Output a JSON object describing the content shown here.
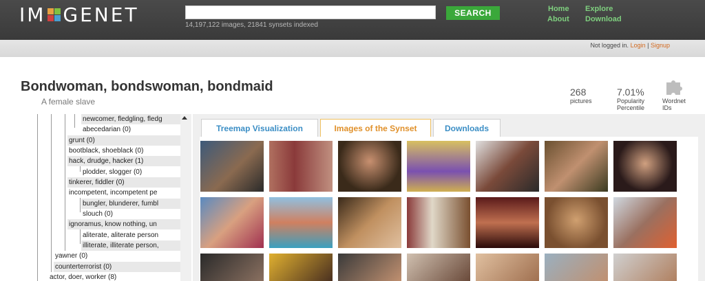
{
  "header": {
    "logo_left": "IM",
    "logo_right": "GENET",
    "search_placeholder": "",
    "search_button": "SEARCH",
    "stats": "14,197,122 images, 21841 synsets indexed",
    "nav": [
      {
        "label": "Home"
      },
      {
        "label": "About"
      },
      {
        "label": "Explore"
      },
      {
        "label": "Download"
      }
    ]
  },
  "login": {
    "text": "Not logged in.",
    "login": "Login",
    "sep": "|",
    "signup": "Signup"
  },
  "synset": {
    "title": "Bondwoman, bondswoman, bondmaid",
    "gloss": "A female slave"
  },
  "stats": [
    {
      "value": "268",
      "label": "pictures"
    },
    {
      "value": "7.01%",
      "label": "Popularity Percentile"
    },
    {
      "value": "",
      "label": "Wordnet IDs"
    }
  ],
  "tabs": [
    {
      "label": "Treemap Visualization"
    },
    {
      "label": "Images of the Synset"
    },
    {
      "label": "Downloads"
    }
  ],
  "tree": [
    {
      "label": "newcomer, fledgling, fledg"
    },
    {
      "label": "abecedarian (0)"
    },
    {
      "label": "grunt (0)"
    },
    {
      "label": "bootblack, shoeblack (0)"
    },
    {
      "label": "hack, drudge, hacker (1)"
    },
    {
      "label": "plodder, slogger (0)"
    },
    {
      "label": "tinkerer, fiddler (0)"
    },
    {
      "label": "incompetent, incompetent pe"
    },
    {
      "label": "bungler, blunderer, fumbl"
    },
    {
      "label": "slouch (0)"
    },
    {
      "label": "ignoramus, know nothing, un"
    },
    {
      "label": "aliterate, aliterate person"
    },
    {
      "label": "illiterate, illiterate person,"
    },
    {
      "label": "yawner (0)"
    },
    {
      "label": "counterterrorist (0)"
    },
    {
      "label": "actor, doer, worker (8)"
    }
  ],
  "colors": {
    "header_bg": "#404040",
    "search_green": "#3aa83a",
    "nav_green": "#7fd07f",
    "tab_active": "#e0902a",
    "tab_blue": "#3b8ec5",
    "link_orange": "#d2691e"
  }
}
